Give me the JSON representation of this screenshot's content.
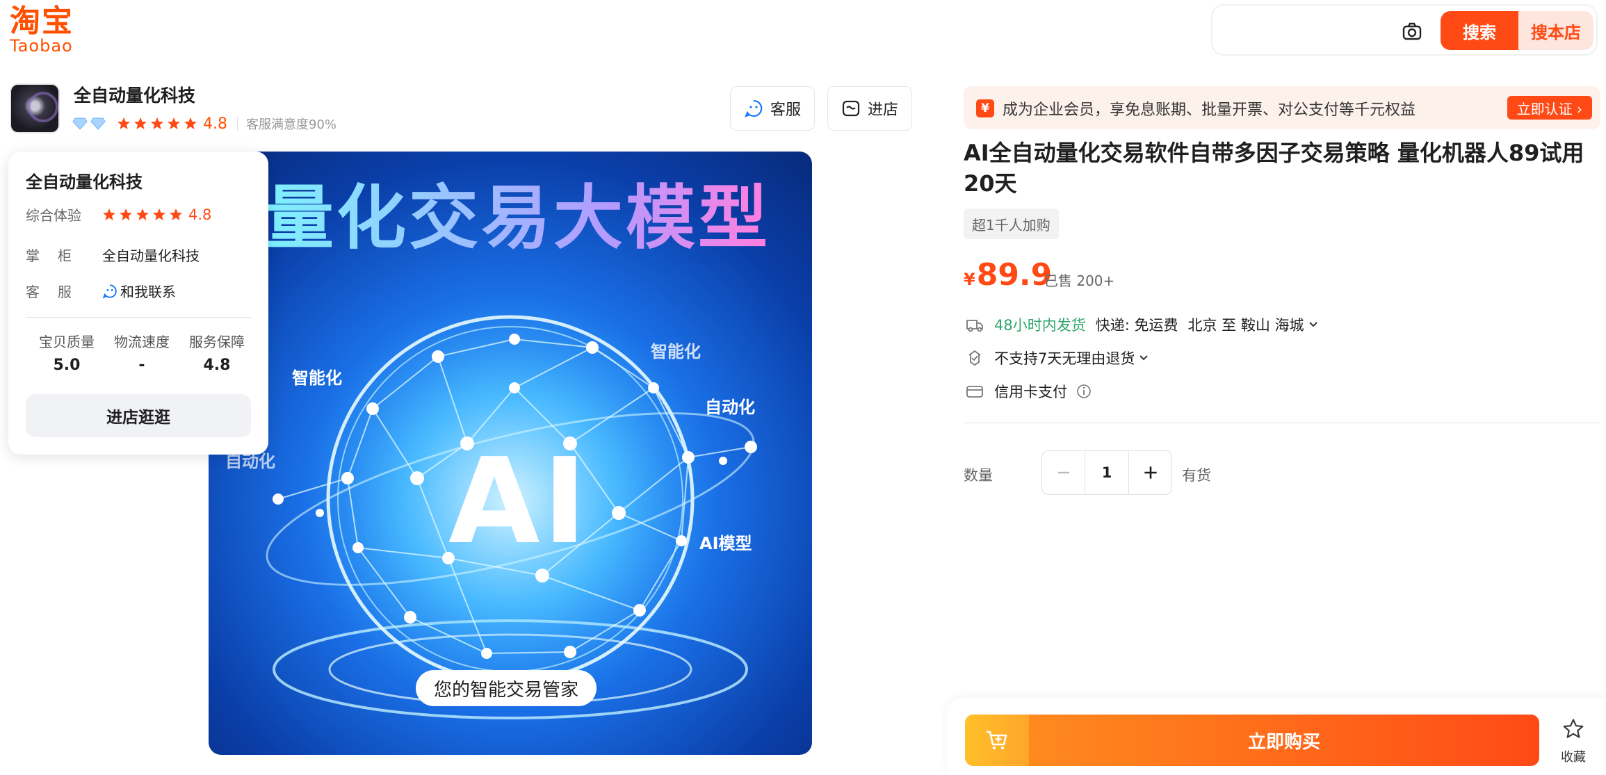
{
  "logo": {
    "cn": "淘宝",
    "en": "Taobao"
  },
  "search": {
    "placeholder": "",
    "search_button": "搜索",
    "shop_search_button": "搜本店"
  },
  "shop": {
    "name": "全自动量化科技",
    "rating": "4.8",
    "service_satisfaction": "客服满意度90%",
    "service_button": "客服",
    "enter_button": "进店"
  },
  "shop_card": {
    "name": "全自动量化科技",
    "overall_label": "综合体验",
    "overall_rating": "4.8",
    "owner_label": "掌柜",
    "owner_value": "全自动量化科技",
    "service_label": "客服",
    "service_value": "和我联系",
    "metrics": [
      {
        "label": "宝贝质量",
        "value": "5.0"
      },
      {
        "label": "物流速度",
        "value": "-"
      },
      {
        "label": "服务保障",
        "value": "4.8"
      }
    ],
    "enter_button": "进店逛逛"
  },
  "hero": {
    "title": "量化交易大模型",
    "center": "AI",
    "tags": [
      "智能化",
      "智能化",
      "自动化",
      "自动化",
      "AI模型"
    ],
    "pill": "您的智能交易管家"
  },
  "promo": {
    "icon": "¥",
    "text": "成为企业会员，享免息账期、批量开票、对公支付等千元权益",
    "cta": "立即认证 ›"
  },
  "product": {
    "title": "AI全自动量化交易软件自带多因子交易策略 量化机器人89试用20天",
    "badge": "超1千人加购",
    "currency": "¥",
    "price": "89.9",
    "sold": "已售 200+"
  },
  "delivery": {
    "time": "48小时内发货",
    "shipping": "快递: 免运费",
    "route": "北京 至 鞍山 海城"
  },
  "returns": {
    "text": "不支持7天无理由退货"
  },
  "payment": {
    "text": "信用卡支付"
  },
  "quantity": {
    "label": "数量",
    "value": "1",
    "stock": "有货"
  },
  "actions": {
    "buy": "立即购买",
    "favorite": "收藏"
  },
  "colors": {
    "brand": "#ff5000",
    "accent": "#ff4a16",
    "green": "#2ea66b"
  }
}
